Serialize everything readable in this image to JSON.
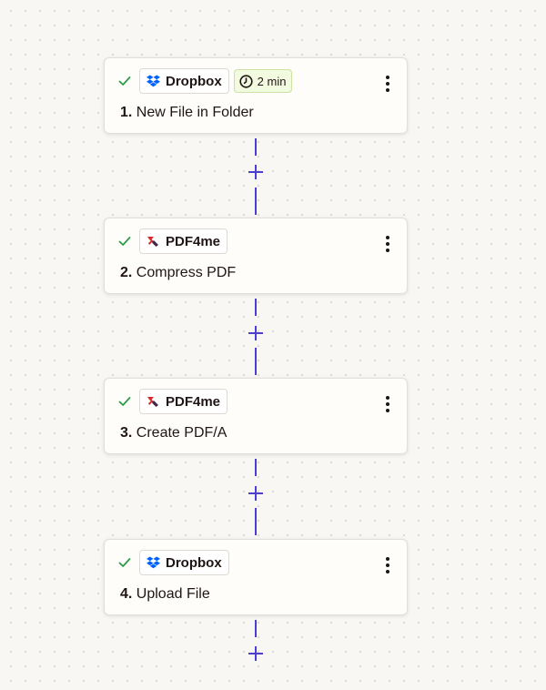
{
  "steps": [
    {
      "app": "Dropbox",
      "app_icon": "dropbox-icon",
      "duration": "2 min",
      "number": "1.",
      "title": "New File in Folder"
    },
    {
      "app": "PDF4me",
      "app_icon": "pdf4me-icon",
      "number": "2.",
      "title": "Compress PDF"
    },
    {
      "app": "PDF4me",
      "app_icon": "pdf4me-icon",
      "number": "3.",
      "title": "Create PDF/A"
    },
    {
      "app": "Dropbox",
      "app_icon": "dropbox-icon",
      "number": "4.",
      "title": "Upload File"
    }
  ],
  "icons": {
    "status": "check-icon",
    "menu": "more-vertical-icon",
    "add": "plus-icon",
    "timer": "clock-icon"
  },
  "colors": {
    "check": "#2d9d4b",
    "connector": "#4b3fcf",
    "dropbox": "#0061ff",
    "pdf4me_red": "#d9262c",
    "pdf4me_dark": "#3b2a4a",
    "time_chip_bg": "#f2fadf",
    "time_chip_border": "#cbe2a3",
    "canvas": "#f8f7f4"
  }
}
